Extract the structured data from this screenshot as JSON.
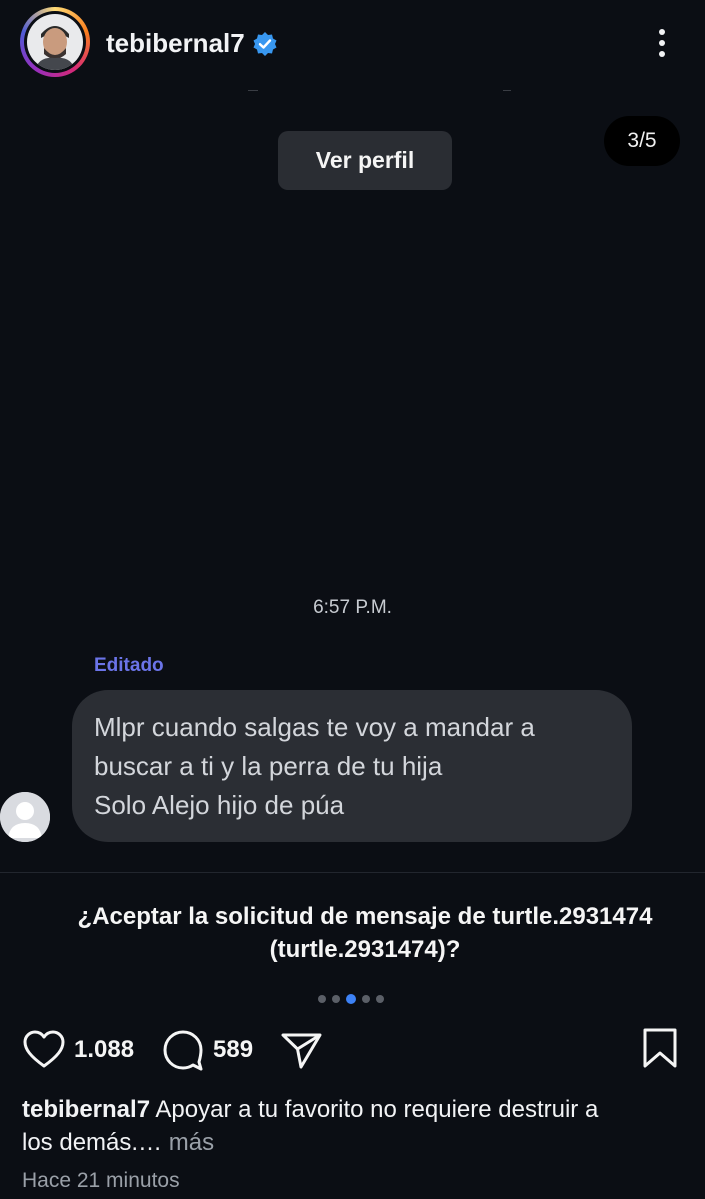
{
  "header": {
    "username": "tebibernal7",
    "verified": true,
    "icons": {
      "verified": "verified-badge-icon",
      "more": "more-vertical-icon"
    }
  },
  "story": {
    "view_profile_label": "Ver perfil",
    "counter": "3/5",
    "message_time": "6:57 P.M.",
    "edited_label": "Editado",
    "message_lines": [
      "Mlpr cuando salgas te voy a mandar a",
      "buscar a ti y la perra de tu hija",
      "Solo Alejo hijo de púa"
    ],
    "request_prompt_line1": "¿Aceptar la solicitud de mensaje de turtle.2931474",
    "request_prompt_line2": "(turtle.2931474)?"
  },
  "carousel": {
    "total": 5,
    "active_index": 2
  },
  "actions": {
    "likes": "1.088",
    "comments": "589",
    "icons": {
      "like": "heart-icon",
      "comment": "comment-icon",
      "share": "send-icon",
      "save": "bookmark-icon"
    }
  },
  "caption": {
    "username": "tebibernal7",
    "text_line1": "Apoyar a tu favorito no requiere destruir a",
    "text_line2": "los demás.…",
    "more": "más"
  },
  "timestamp": "Hace 21 minutos",
  "colors": {
    "background": "#0b0e14",
    "bubble": "#2b2e34",
    "edited": "#6b74e8",
    "active_dot": "#3d82f6",
    "verified": "#3897f0"
  }
}
